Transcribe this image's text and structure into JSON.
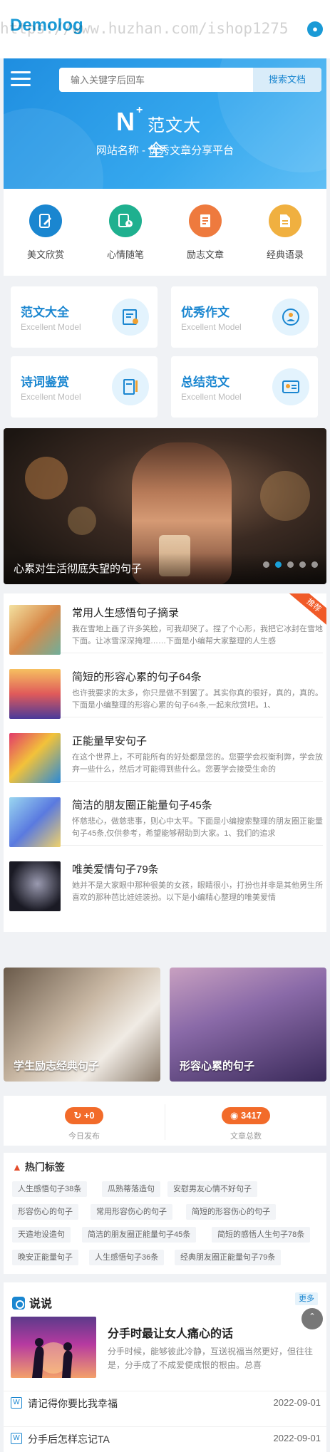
{
  "header": {
    "brand": "Demolog",
    "watermark": "https://www.huzhan.com/ishop1275"
  },
  "hero": {
    "search_placeholder": "输入关键字后回车",
    "search_button": "搜索文档",
    "logo_letter": "N",
    "logo_text": "范文大全",
    "tagline": "网站名称 - 优秀文章分享平台"
  },
  "categories": [
    {
      "label": "美文欣赏",
      "icon": "pen-icon",
      "color": "#1a86d0"
    },
    {
      "label": "心情随笔",
      "icon": "notebook-clock-icon",
      "color": "#1fb08f"
    },
    {
      "label": "励志文章",
      "icon": "document-icon",
      "color": "#ee7a3e"
    },
    {
      "label": "经典语录",
      "icon": "file-list-icon",
      "color": "#f0b040"
    }
  ],
  "cards": [
    {
      "title": "范文大全",
      "subtitle": "Excellent Model",
      "icon": "certificate-icon"
    },
    {
      "title": "优秀作文",
      "subtitle": "Excellent Model",
      "icon": "award-person-icon"
    },
    {
      "title": "诗词鉴赏",
      "subtitle": "Excellent Model",
      "icon": "book-pen-icon"
    },
    {
      "title": "总结范文",
      "subtitle": "Excellent Model",
      "icon": "id-card-icon"
    }
  ],
  "banner": {
    "title": "心累对生活彻底失望的句子",
    "slide_count": 5,
    "active_slide": 2
  },
  "articles": {
    "ribbon": "推荐",
    "items": [
      {
        "title": "常用人生感悟句子摘录",
        "desc": "我在雪地上画了许多笑脸，可我却哭了。捏了个心形，我把它冰封在雪地下面。让冰雪深深掩埋……下面是小编帮大家整理的人生感"
      },
      {
        "title": "简短的形容心累的句子64条",
        "desc": "也许我要求的太多，你只是做不到罢了。其实你真的很好，真的，真的。下面是小编整理的形容心累的句子64条,一起来欣赏吧。1、"
      },
      {
        "title": "正能量早安句子",
        "desc": "在这个世界上，不可能所有的好处都是您的。您要学会权衡利弊，学会放弃一些什么，然后才可能得到些什么。您要学会接受生命的"
      },
      {
        "title": "简洁的朋友圈正能量句子45条",
        "desc": "怀慈悲心，做慈悲事，则心中太平。下面是小编搜索整理的朋友圈正能量句子45条,仅供参考，希望能够帮助到大家。1、我们的追求"
      },
      {
        "title": "唯美爱情句子79条",
        "desc": "她并不是大家眼中那种很美的女孩，眼睛很小，打扮也并非是其他男生所喜欢的那种芭比娃娃装扮。以下是小编精心整理的唯美爱情"
      }
    ]
  },
  "photos": [
    {
      "caption": "学生励志经典句子"
    },
    {
      "caption": "形容心累的句子"
    }
  ],
  "stats": [
    {
      "value": "+0",
      "label": "今日发布",
      "icon": "refresh-icon"
    },
    {
      "value": "3417",
      "label": "文章总数",
      "icon": "record-icon"
    }
  ],
  "tags": {
    "heading": "热门标签",
    "items": [
      "人生感悟句子38条",
      "瓜熟蒂落造句",
      "安慰男友心情不好句子",
      "形容伤心的句子",
      "常用形容伤心的句子",
      "简短的形容伤心的句子",
      "天造地设造句",
      "简洁的朋友圈正能量句子45条",
      "简短的感悟人生句子78条",
      "晚安正能量句子",
      "人生感悟句子36条",
      "经典朋友圈正能量句子79条"
    ]
  },
  "shuoshuo": {
    "heading": "说说",
    "more": "更多",
    "feature_title": "分手时最让女人痛心的话",
    "feature_desc": "分手时候，能够彼此冷静，互送祝福当然更好，但往往是，分手成了不成爱便成恨的根由。总喜",
    "list": [
      {
        "title": "请记得你要比我幸福",
        "date": "2022-09-01"
      },
      {
        "title": "分手后怎样忘记TA",
        "date": "2022-09-01"
      }
    ]
  }
}
